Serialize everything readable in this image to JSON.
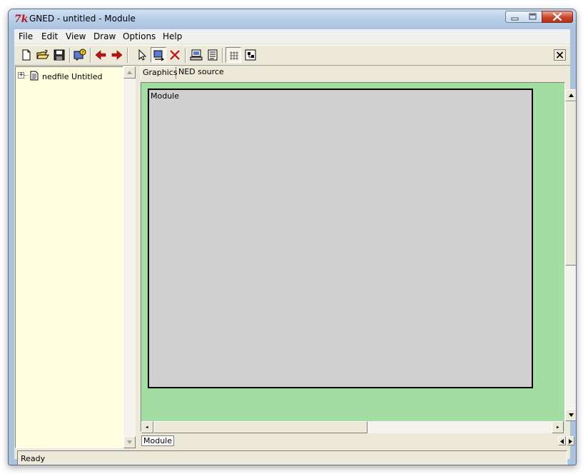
{
  "window": {
    "title": "GNED - untitled - Module",
    "app_icon_text": "7k",
    "controls": {
      "minimize": "minimize",
      "maximize": "maximize",
      "close": "close"
    }
  },
  "menu": {
    "items": [
      {
        "id": "file",
        "label": "File"
      },
      {
        "id": "edit",
        "label": "Edit"
      },
      {
        "id": "view",
        "label": "View"
      },
      {
        "id": "draw",
        "label": "Draw"
      },
      {
        "id": "options",
        "label": "Options"
      },
      {
        "id": "help",
        "label": "Help"
      }
    ]
  },
  "toolbar": {
    "buttons": [
      {
        "name": "new-file",
        "icon": "new-document-icon"
      },
      {
        "name": "open-file",
        "icon": "open-folder-icon"
      },
      {
        "name": "save-file",
        "icon": "save-disk-icon"
      },
      {
        "name": "properties",
        "icon": "properties-icon"
      },
      {
        "name": "back",
        "icon": "arrow-left-icon",
        "color": "#c01010"
      },
      {
        "name": "forward",
        "icon": "arrow-right-icon",
        "color": "#c01010"
      },
      {
        "name": "select-tool",
        "icon": "pointer-icon"
      },
      {
        "name": "draw-connection",
        "icon": "draw-module-icon",
        "pressed": true
      },
      {
        "name": "delete",
        "icon": "delete-x-icon",
        "color": "#c01010"
      },
      {
        "name": "graphics-view",
        "icon": "monitor-icon"
      },
      {
        "name": "source-view",
        "icon": "text-view-icon"
      },
      {
        "name": "grid",
        "icon": "grid-icon",
        "pressed": true
      },
      {
        "name": "layout",
        "icon": "layout-icon"
      }
    ]
  },
  "tree": {
    "items": [
      {
        "label": "nedfile Untitled",
        "expanded": false,
        "icon": "document-icon"
      }
    ]
  },
  "editor": {
    "tabs": [
      {
        "label": "Graphics",
        "active": true
      },
      {
        "label": "NED source",
        "active": false
      }
    ],
    "canvas_background": "#a2dea2",
    "module": {
      "title": "Module",
      "fill": "#d0d0d0"
    },
    "bottom_tabs": [
      {
        "label": "Module",
        "active": true
      }
    ]
  },
  "status": {
    "text": "Ready"
  }
}
